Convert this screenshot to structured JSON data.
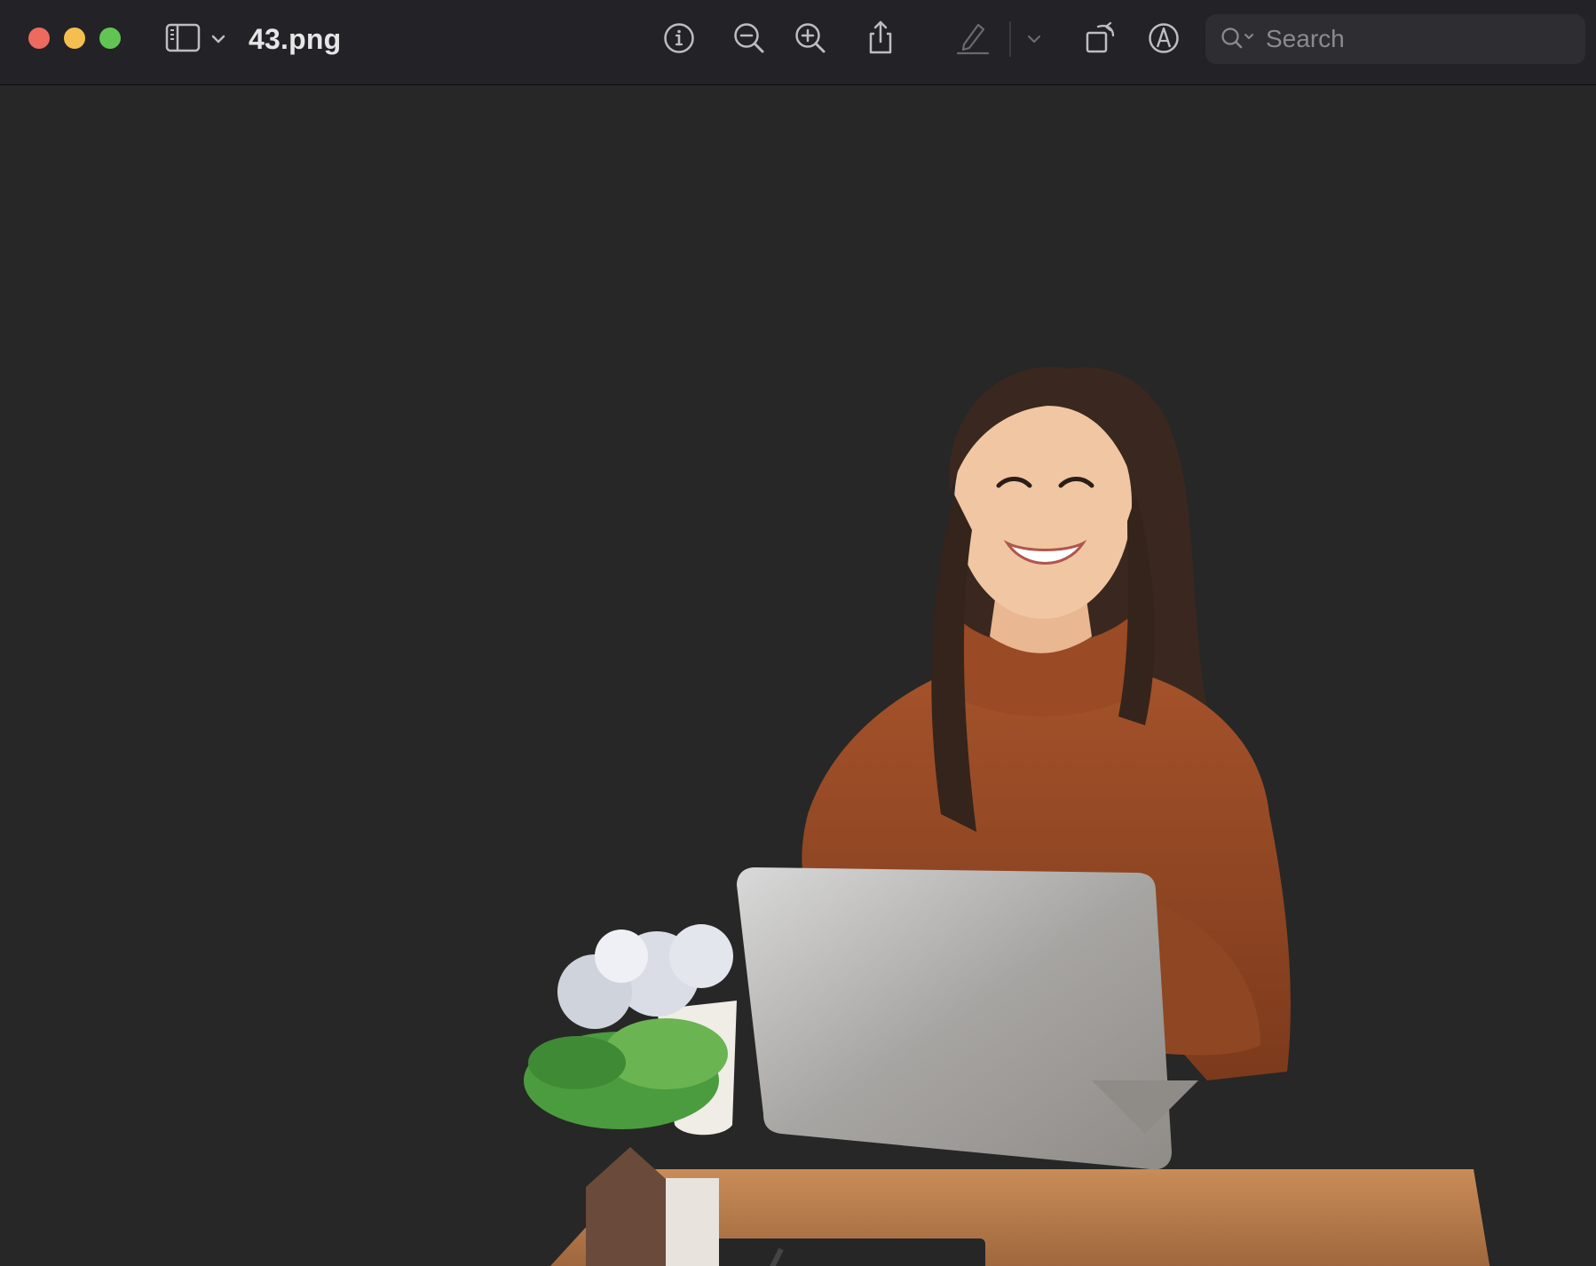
{
  "window": {
    "title": "43.png"
  },
  "toolbar": {
    "icons": [
      "sidebar-icon",
      "chevron-down-icon",
      "info-icon",
      "zoom-out-icon",
      "zoom-in-icon",
      "share-icon",
      "highlight-pen-icon",
      "chevron-down-icon",
      "rotate-icon",
      "markup-icon"
    ]
  },
  "search": {
    "placeholder": "Search",
    "value": ""
  },
  "colors": {
    "titlebar": "#232227",
    "canvas": "#272727",
    "close": "#ed6a5e",
    "minimize": "#f4bf4f",
    "maximize": "#61c554"
  }
}
